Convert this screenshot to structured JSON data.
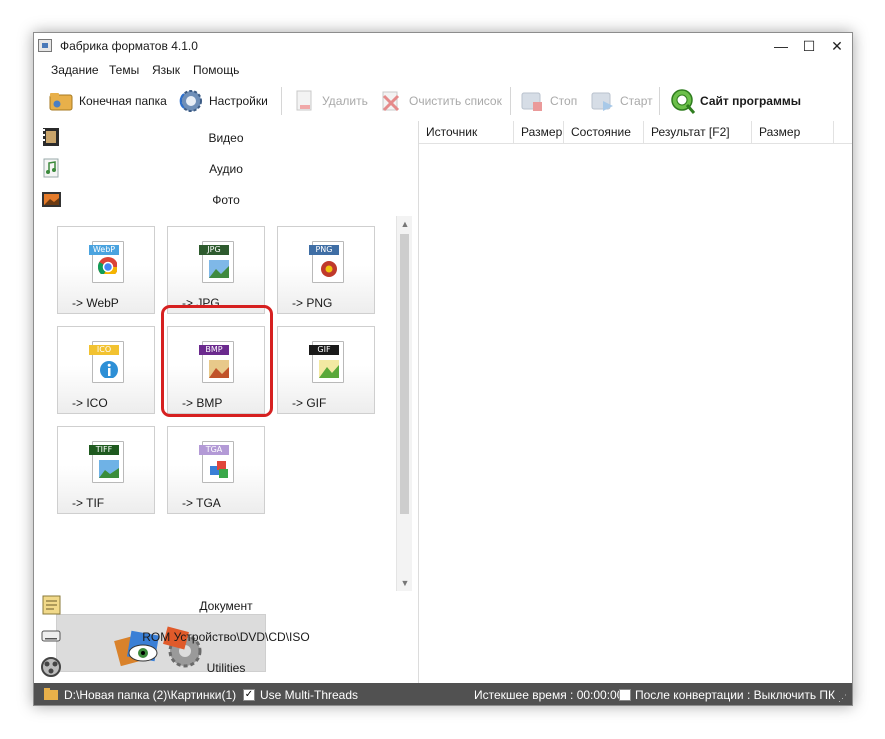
{
  "window": {
    "title": "Фабрика форматов 4.1.0",
    "controls": {
      "minimize": "—",
      "maximize": "☐",
      "close": "✕"
    }
  },
  "menu": [
    "Задание",
    "Темы",
    "Язык",
    "Помощь"
  ],
  "toolbar": {
    "output_folder": "Конечная папка",
    "settings": "Настройки",
    "delete": "Удалить",
    "clear_list": "Очистить список",
    "stop": "Стоп",
    "start": "Старт",
    "website": "Сайт программы"
  },
  "categories": {
    "video": "Видео",
    "audio": "Аудио",
    "photo": "Фото",
    "document": "Документ",
    "rom": "ROM Устройство\\DVD\\CD\\ISO",
    "utilities": "Utilities"
  },
  "photo_formats": [
    {
      "label": "-> WebP",
      "tag": "WebP",
      "tag_color": "#4aa3df",
      "selected": false
    },
    {
      "label": "-> JPG",
      "tag": "JPG",
      "tag_color": "#2e5b2e",
      "selected": true
    },
    {
      "label": "-> PNG",
      "tag": "PNG",
      "tag_color": "#3f6ea5",
      "selected": false
    },
    {
      "label": "-> ICO",
      "tag": "ICO",
      "tag_color": "#f2c230",
      "selected": false
    },
    {
      "label": "-> BMP",
      "tag": "BMP",
      "tag_color": "#6b2a8e",
      "selected": false
    },
    {
      "label": "-> GIF",
      "tag": "GIF",
      "tag_color": "#1a1a1a",
      "selected": false
    },
    {
      "label": "-> TIF",
      "tag": "TIFF",
      "tag_color": "#1f5a1f",
      "selected": false
    },
    {
      "label": "-> TGA",
      "tag": "TGA",
      "tag_color": "#b39ad6",
      "selected": false
    }
  ],
  "file_list": {
    "columns": [
      "Источник",
      "Размер",
      "Состояние",
      "Результат [F2]",
      "Размер"
    ],
    "rows": []
  },
  "status": {
    "path": "D:\\Новая папка (2)\\Картинки(1)",
    "multithreads_label": "Use Multi-Threads",
    "multithreads_checked": true,
    "elapsed": "Истекшее время : 00:00:00",
    "after_convert_label": "После конвертации : Выключить ПК",
    "after_convert_checked": false
  }
}
